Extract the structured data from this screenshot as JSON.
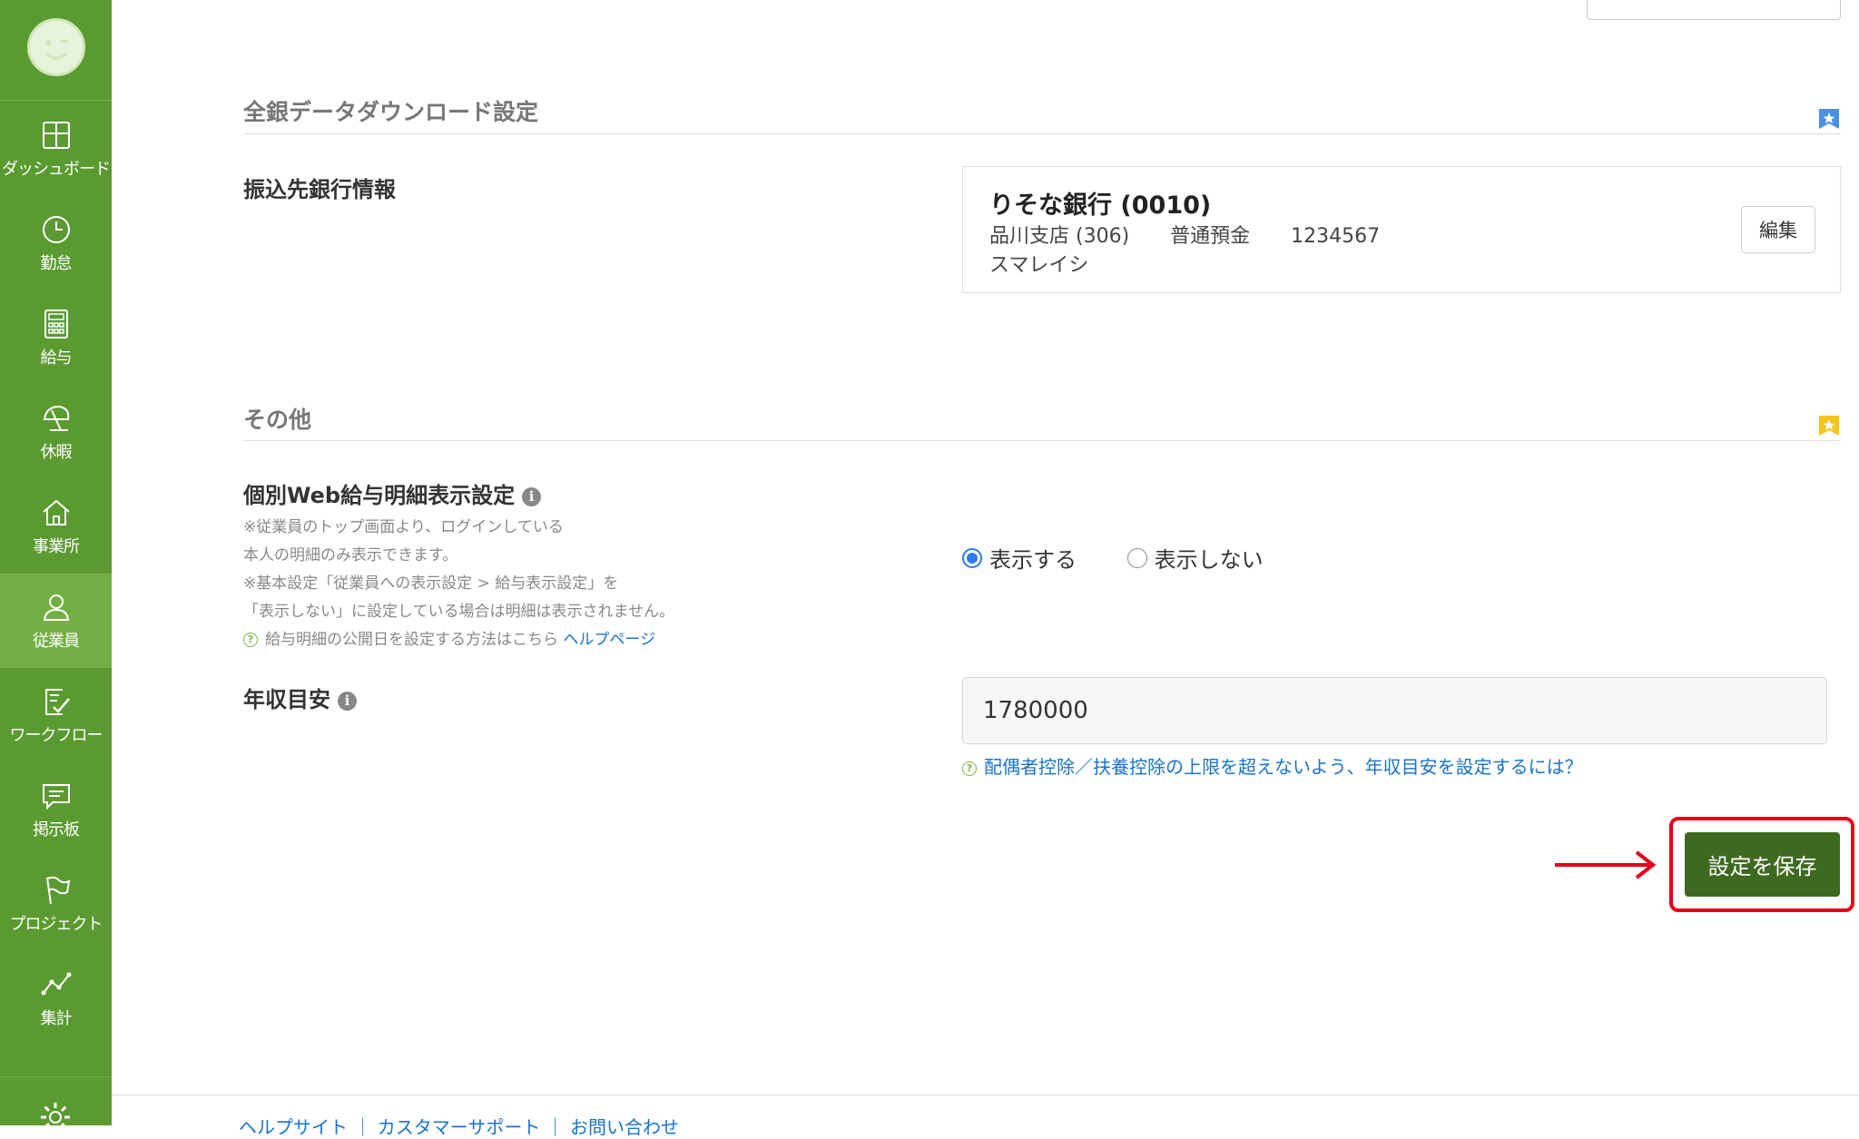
{
  "sidebar": {
    "items": [
      {
        "label": "ダッシュボード",
        "icon": "dashboard-icon"
      },
      {
        "label": "勤怠",
        "icon": "clock-icon"
      },
      {
        "label": "給与",
        "icon": "calculator-icon"
      },
      {
        "label": "休暇",
        "icon": "beach-umbrella-icon"
      },
      {
        "label": "事業所",
        "icon": "home-icon"
      },
      {
        "label": "従業員",
        "icon": "person-icon",
        "active": true
      },
      {
        "label": "ワークフロー",
        "icon": "checklist-icon"
      },
      {
        "label": "掲示板",
        "icon": "message-board-icon"
      },
      {
        "label": "プロジェクト",
        "icon": "flag-icon"
      },
      {
        "label": "集計",
        "icon": "line-chart-icon"
      }
    ],
    "accent_color": "#5b9a31",
    "active_color": "#74af45"
  },
  "bank_section": {
    "title": "全銀データダウンロード設定",
    "badge_color": "#4a90e2",
    "transfer_label": "振込先銀行情報",
    "bank_name": "りそな銀行 (0010)",
    "branch": "品川支店 (306)",
    "account_type": "普通預金",
    "account_number": "1234567",
    "holder": "スマレイシ",
    "edit_label": "編集"
  },
  "other_section": {
    "title": "その他",
    "badge_color": "#f5c518",
    "web_payslip_label": "個別Web給与明細表示設定",
    "notes": [
      "※従業員のトップ画面より、ログインしている",
      "本人の明細のみ表示できます。",
      "※基本設定「従業員への表示設定 > 給与表示設定」を",
      "「表示しない」に設定している場合は明細は表示されません。"
    ],
    "help_text": "給与明細の公開日を設定する方法はこちら",
    "help_link": "ヘルプページ",
    "radio_show": "表示する",
    "radio_hide": "表示しない",
    "selected": "show",
    "income_label": "年収目安",
    "income_value": "1780000",
    "income_help": "配偶者控除／扶養控除の上限を超えないよう、年収目安を設定するには？"
  },
  "save_label": "設定を保存",
  "save_color": "#3e6a1f",
  "highlight_color": "#e5001a",
  "footer_text": "ヘルプサイト ｜ カスタマーサポート ｜ お問い合わせ"
}
